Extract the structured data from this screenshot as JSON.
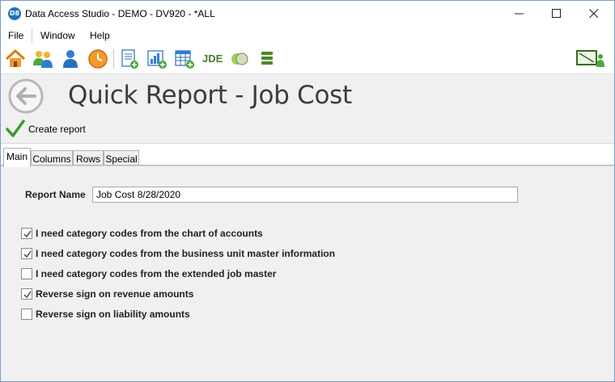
{
  "window": {
    "app_icon_text": "D8",
    "title": "Data Access Studio - DEMO - DV920 - *ALL"
  },
  "menu": {
    "items": [
      {
        "label": "File"
      },
      {
        "label": "Window"
      },
      {
        "label": "Help"
      }
    ]
  },
  "toolbar": {
    "jde_label": "JDE",
    "icons": [
      "home-icon",
      "users-icon",
      "user-icon",
      "clock-icon",
      "new-report-icon",
      "new-chart-report-icon",
      "new-grid-report-icon",
      "jde-icon",
      "venn-icon",
      "stack-icon",
      "presentation-icon"
    ]
  },
  "header": {
    "title": "Quick Report - Job Cost"
  },
  "actions": {
    "create_report": "Create report"
  },
  "tabs": [
    {
      "label": "Main",
      "active": true
    },
    {
      "label": "Columns",
      "active": false
    },
    {
      "label": "Rows",
      "active": false
    },
    {
      "label": "Special",
      "active": false
    }
  ],
  "form": {
    "report_name_label": "Report Name",
    "report_name_value": "Job Cost 8/28/2020",
    "options": [
      {
        "label": "I need category codes from the chart of accounts",
        "checked": true
      },
      {
        "label": "I need category codes from the business unit master information",
        "checked": true
      },
      {
        "label": "I need category codes from the extended job master",
        "checked": false
      },
      {
        "label": "Reverse sign on revenue amounts",
        "checked": true
      },
      {
        "label": "Reverse sign on liability amounts",
        "checked": false
      }
    ]
  },
  "colors": {
    "accent_blue": "#1e73be",
    "check_green": "#3d9a2b",
    "title_gray": "#3c3c3c"
  }
}
